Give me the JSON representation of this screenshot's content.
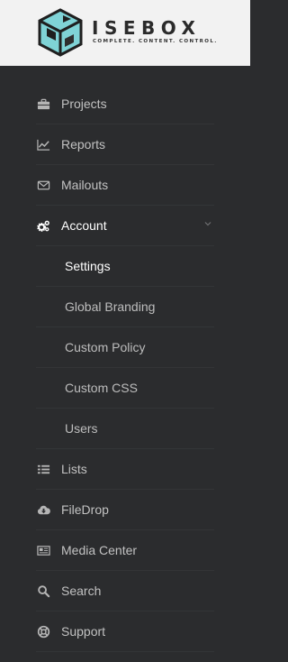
{
  "logo": {
    "wordmark": "ISEBOX",
    "tagline": "COMPLETE. CONTENT. CONTROL.",
    "mark_colors": [
      "#7fd3d6",
      "#1f1f1f"
    ]
  },
  "nav": [
    {
      "label": "Projects",
      "icon": "briefcase-icon"
    },
    {
      "label": "Reports",
      "icon": "line-chart-icon"
    },
    {
      "label": "Mailouts",
      "icon": "envelope-icon"
    },
    {
      "label": "Account",
      "icon": "gears-icon",
      "active": true,
      "expanded": true,
      "children": [
        {
          "label": "Settings",
          "current": true
        },
        {
          "label": "Global Branding"
        },
        {
          "label": "Custom Policy"
        },
        {
          "label": "Custom CSS"
        },
        {
          "label": "Users"
        }
      ]
    },
    {
      "label": "Lists",
      "icon": "list-icon"
    },
    {
      "label": "FileDrop",
      "icon": "cloud-download-icon"
    },
    {
      "label": "Media Center",
      "icon": "newspaper-icon"
    },
    {
      "label": "Search",
      "icon": "search-icon"
    },
    {
      "label": "Support",
      "icon": "life-ring-icon"
    }
  ],
  "colors": {
    "sidebar_bg": "#2b2c2e",
    "header_bg": "#f2f2f2",
    "text": "#c2c2c2",
    "active_text": "#ffffff"
  }
}
